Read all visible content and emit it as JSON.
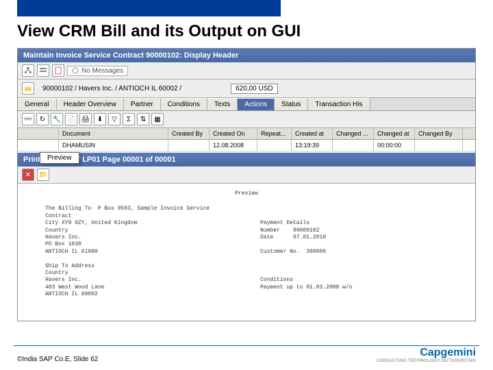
{
  "page": {
    "title": "View CRM Bill and its Output on GUI",
    "copyright": "©India SAP Co.E, Slide 62",
    "logo": "Capgemini",
    "logo_tag": "CONSULTING.TECHNOLOGY.OUTSOURCING"
  },
  "window": {
    "title": "Maintain Invoice Service Contract 90000102: Display Header",
    "messages_btn": "No Messages",
    "context_line": "90000102 / Havers Inc. / ANTIOCH IL 60002 /",
    "amount": "620,00 USD"
  },
  "tabs": [
    "General",
    "Header Overview",
    "Partner",
    "Conditions",
    "Texts",
    "Actions",
    "Status",
    "Transaction His"
  ],
  "active_tab": 5,
  "grid": {
    "overlay_label": "Preview",
    "headers": [
      "",
      "Document",
      "Created By",
      "Created On",
      "Repeat...",
      "Created at",
      "Changed ...",
      "Changed at",
      "Changed By"
    ],
    "row": [
      "",
      "DHAMUSIN",
      "",
      "12.08.2008",
      "",
      "13:19:39",
      "",
      "00:00:00",
      ""
    ]
  },
  "preview": {
    "title": "Print Preview of LP01 Page 00001 of 00001",
    "heading": "Preview",
    "bill_to_label": "The Billing To",
    "addr1": "P Box 9593",
    "doc_title": "Sample Invoice Service Contract",
    "city": "City XY9 9ZY, United Kingdom",
    "country": "Country",
    "company": "Havers Inc.",
    "street": "PO Box 1030",
    "citystate": "ANTIOCH IL 61000",
    "pay_label": "Payment Details",
    "num_label": "Number",
    "num_val": "90000102",
    "date_label": "Date",
    "date_val": "07.01.2010",
    "cust_label": "Customer No.",
    "cust_val": "300000",
    "ship_label": "Ship To Address",
    "ship_country": "Country",
    "ship_company": "Havers Inc.",
    "ship_street": "403 West Wood Lane",
    "ship_citystate": "ANTIOCH IL 60002",
    "cond_label": "Conditions",
    "cond_text": "Payment up to 01.03.2008 w/o"
  }
}
